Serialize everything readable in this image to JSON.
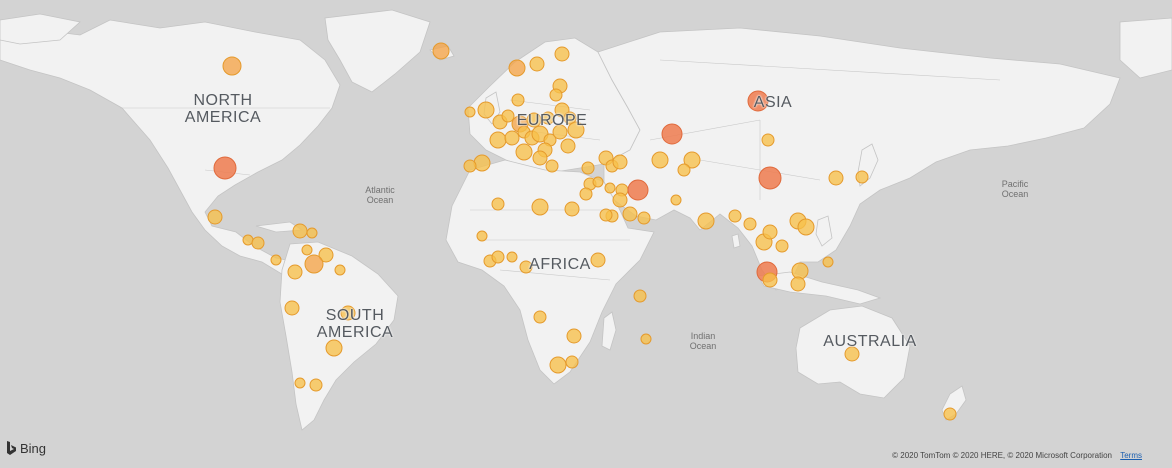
{
  "map": {
    "provider": "Bing",
    "attribution": "© 2020 TomTom © 2020 HERE, © 2020 Microsoft Corporation",
    "terms_label": "Terms",
    "colors": {
      "ocean": "#d3d3d3",
      "land": "#f2f2f2",
      "border": "#c4c4c4",
      "bubble_low": "#f7c04a",
      "bubble_mid": "#f5a448",
      "bubble_high": "#ef7b4f",
      "bubble_stroke": "#e59a2c"
    },
    "continent_labels": {
      "north_america": "NORTH\nAMERICA",
      "south_america": "SOUTH\nAMERICA",
      "europe": "EUROPE",
      "africa": "AFRICA",
      "asia": "ASIA",
      "australia": "AUSTRALIA"
    },
    "ocean_labels": {
      "atlantic": "Atlantic\nOcean",
      "pacific": "Pacific\nOcean",
      "indian": "Indian\nOcean"
    }
  }
}
